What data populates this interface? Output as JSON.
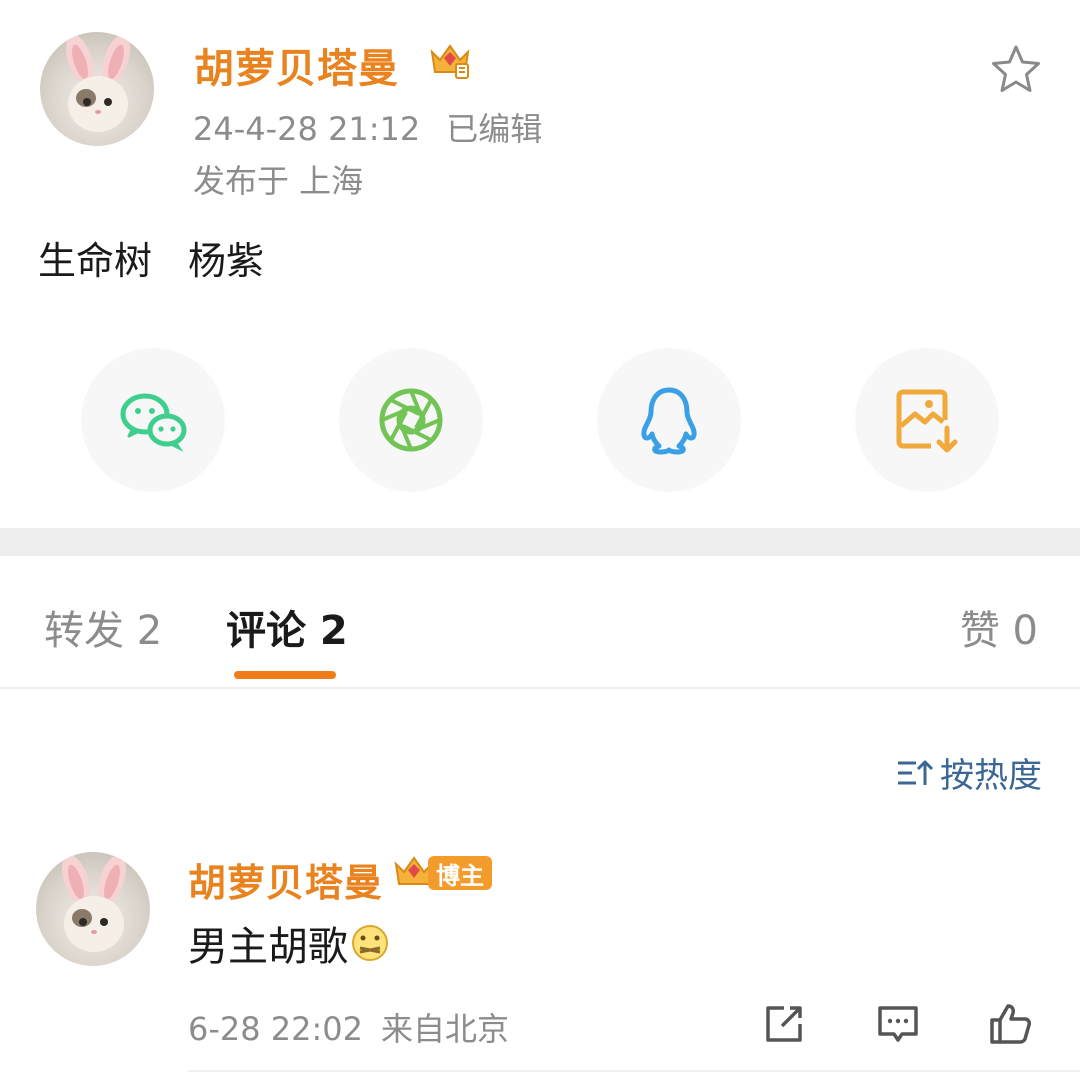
{
  "post": {
    "author_name": "胡萝贝塔曼",
    "time": "24-4-28 21:12",
    "edited_label": "已编辑",
    "location": "发布于 上海",
    "content": [
      "生命树",
      "杨紫"
    ],
    "icons": {
      "star": "star-icon",
      "crown": "vip-crown-icon"
    }
  },
  "share": {
    "items": [
      {
        "name": "wechat",
        "icon": "wechat-icon",
        "color": "#3ecf8e"
      },
      {
        "name": "moments",
        "icon": "moments-icon",
        "color": "#72c455"
      },
      {
        "name": "qq",
        "icon": "qq-icon",
        "color": "#3aa0e6"
      },
      {
        "name": "save-image",
        "icon": "save-image-icon",
        "color": "#f2a93b"
      }
    ]
  },
  "tabs": {
    "repost": "转发 2",
    "comments": "评论 2",
    "likes": "赞 0",
    "active": "comments",
    "accent_color": "#f07d1a"
  },
  "sort": {
    "label": "按热度",
    "icon": "sort-icon"
  },
  "comment": {
    "author_name": "胡萝贝塔曼",
    "badge": "博主",
    "text": "男主胡歌",
    "emoji": "zipped-mouth-emoji",
    "time": "6-28 22:02",
    "source": "来自北京",
    "actions": [
      "share-icon",
      "reply-icon",
      "like-icon"
    ]
  },
  "colors": {
    "author": "#e8831f",
    "meta": "#8c8c8c",
    "link": "#3a6794",
    "badge": "#f39c2c"
  }
}
